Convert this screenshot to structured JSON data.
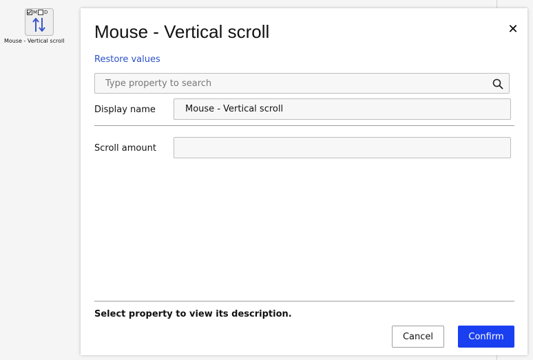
{
  "canvas_node": {
    "flag_m": "M",
    "flag_d": "D",
    "flag_m_checked": true,
    "flag_d_checked": false,
    "icon": "vertical-scroll-arrows-icon",
    "label": "Mouse - Vertical scroll"
  },
  "dialog": {
    "title": "Mouse - Vertical scroll",
    "close_icon": "close-icon",
    "restore_label": "Restore values",
    "search": {
      "placeholder": "Type property to search",
      "value": "",
      "icon": "search-icon"
    },
    "properties": [
      {
        "label": "Display name",
        "value": "Mouse - Vertical scroll"
      },
      {
        "label": "Scroll amount",
        "value": ""
      }
    ],
    "description": "Select property to view its description.",
    "cancel_label": "Cancel",
    "confirm_label": "Confirm"
  },
  "colors": {
    "accent": "#1a3ff0",
    "link": "#2b50c8"
  }
}
